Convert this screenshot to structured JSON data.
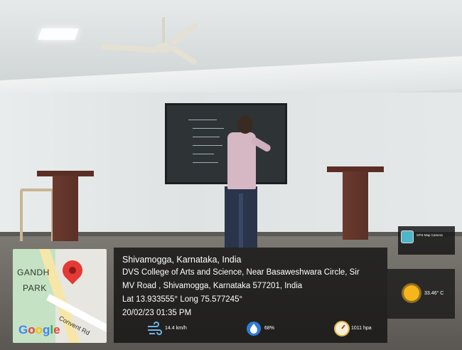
{
  "map": {
    "place_line1": "GANDH",
    "place_line2": "PARK",
    "road_label": "Convent Rd",
    "provider": "Google",
    "provider_colors": [
      "#4285f4",
      "#ea4335",
      "#fbbc05",
      "#4285f4",
      "#34a853",
      "#ea4335"
    ],
    "pin_icon": "location-pin-icon"
  },
  "location": {
    "title": "Shivamogga, Karnataka, India",
    "address_line1": "DVS College of Arts and Science, Near Basaweshwara Circle, Sir",
    "address_line2": "MV Road , Shivamogga, Karnataka 577201, India",
    "coordinates": "Lat 13.933555° Long 75.577245°",
    "datetime": "20/02/23 01:35 PM"
  },
  "weather": {
    "wind": "14.4 km/h",
    "humidity": "68%",
    "pressure": "1011 hpa",
    "temperature": "33.46° C"
  },
  "app": {
    "logo_icon": "gps-camera-logo-icon",
    "name": "GPS Map Camera"
  }
}
